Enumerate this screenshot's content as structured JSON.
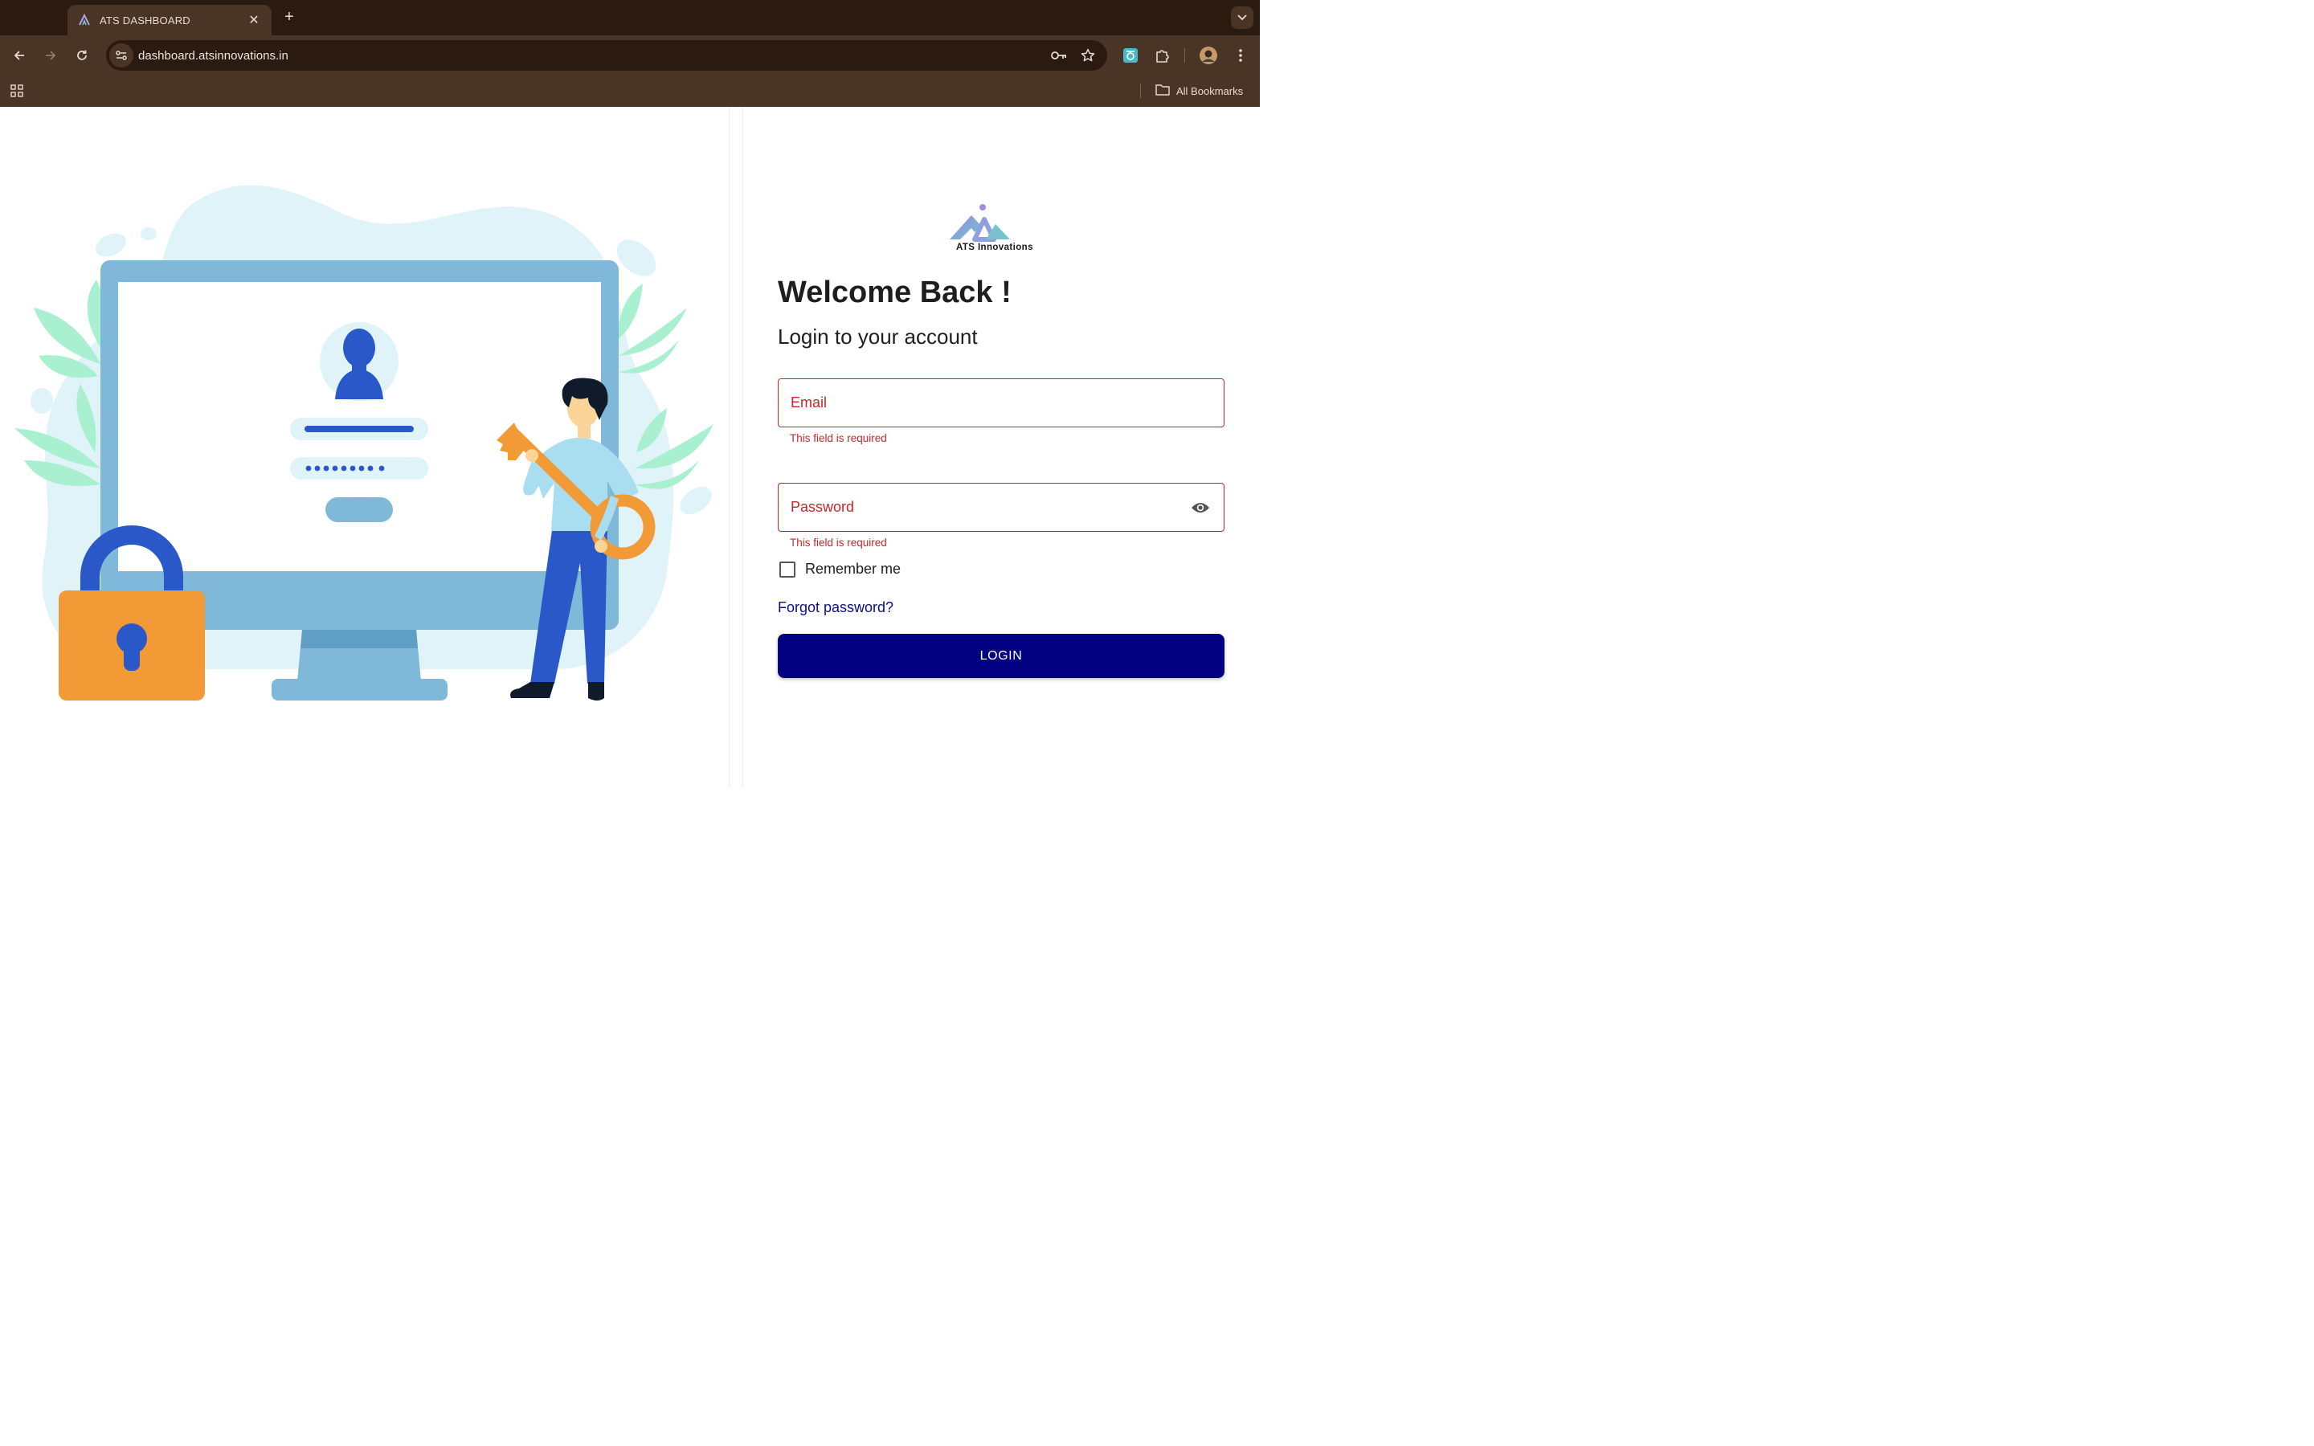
{
  "browser": {
    "tab_title": "ATS DASHBOARD",
    "url": "dashboard.atsinnovations.in",
    "bookmarks_label": "All Bookmarks",
    "theme_colors": {
      "frame": "#2a1a10",
      "toolbar": "#4a3426"
    }
  },
  "login": {
    "logo_text": "ATS Innovations",
    "heading": "Welcome Back !",
    "subheading": "Login to your account",
    "email": {
      "placeholder": "Email",
      "value": "",
      "error": "This field is required"
    },
    "password": {
      "placeholder": "Password",
      "value": "",
      "error": "This field is required"
    },
    "remember_label": "Remember me",
    "remember_checked": false,
    "forgot_label": "Forgot password?",
    "login_label": "LOGIN"
  },
  "colors": {
    "error": "#c62828",
    "primary_button": "#020181",
    "link": "#0d0d8a",
    "illustration_monitor": "#7fb8d8",
    "illustration_orange": "#f29a36",
    "illustration_blue": "#2b58c9"
  },
  "icons": {
    "tab_favicon": "ats-logo-icon",
    "tab_close": "close-icon",
    "new_tab": "plus-icon",
    "tab_list": "chevron-down-icon",
    "back": "arrow-left-icon",
    "forward": "arrow-right-icon",
    "reload": "reload-icon",
    "site_info": "tune-icon",
    "password_manager": "key-icon",
    "bookmark_star": "star-icon",
    "extensions": "puzzle-icon",
    "menu": "more-vertical-icon",
    "apps": "apps-grid-icon",
    "bookmarks_folder": "folder-icon",
    "password_visibility": "eye-icon"
  }
}
